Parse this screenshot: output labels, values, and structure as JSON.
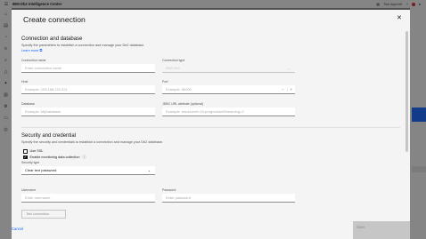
{
  "app": {
    "title": "IBM Db2 Intelligence Center",
    "trial": "Trial days left"
  },
  "modal": {
    "title": "Create connection",
    "close_glyph": "✕",
    "section_db": {
      "title": "Connection and database",
      "desc": "Specify the parameters to establish a connection and manage your Db2 database.",
      "learn_more": "Learn more"
    },
    "fields": {
      "connection_name": {
        "label": "Connection name",
        "placeholder": "Enter connection name"
      },
      "connection_type": {
        "label": "Connection type",
        "value": "IBM Db2"
      },
      "host": {
        "label": "Host",
        "placeholder": "Example: 193.168.122.221"
      },
      "port": {
        "label": "Port",
        "placeholder": "Example: 50000"
      },
      "database": {
        "label": "Database",
        "placeholder": "Example: MyDatabase"
      },
      "jdbc": {
        "label": "JDBC URL attribute (optional)",
        "placeholder": "Example: traceLevel=10;progressiveStreaming=2"
      },
      "username": {
        "label": "Username",
        "placeholder": "Enter username"
      },
      "password": {
        "label": "Password",
        "placeholder": "Enter password"
      }
    },
    "section_security": {
      "title": "Security and credential",
      "desc": "Specify the security and credentials to establish a connection and manage your Db2 database."
    },
    "use_ssl": {
      "label": "Use SSL",
      "checked": false
    },
    "monitoring": {
      "label": "Enable monitoring data collection",
      "checked": true
    },
    "security_type": {
      "label": "Security type",
      "value": "Clear text password"
    },
    "test_connection": "Test connection",
    "cancel": "Cancel",
    "save": "Save"
  }
}
